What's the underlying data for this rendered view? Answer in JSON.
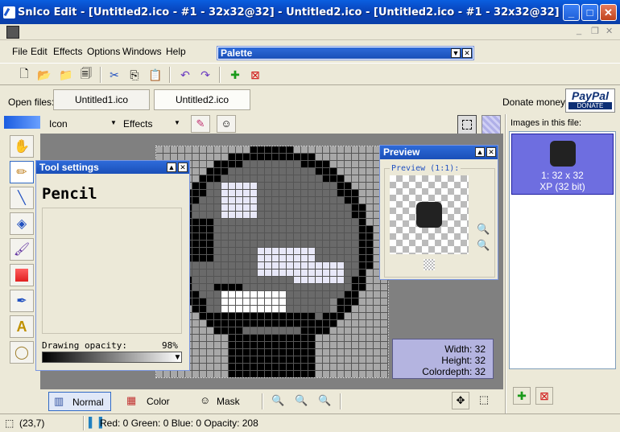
{
  "window": {
    "title": "SnIco Edit - [Untitled2.ico - #1 - 32x32@32] - Untitled2.ico - [Untitled2.ico - #1 - 32x32@32]"
  },
  "menu": [
    "File",
    "Edit",
    "Effects",
    "Options",
    "Windows",
    "Help"
  ],
  "palette": {
    "title": "Palette"
  },
  "open_files": {
    "label": "Open files:",
    "tabs": [
      "Untitled1.ico",
      "Untitled2.ico"
    ],
    "donate_label": "Donate money:",
    "paypal_top": "PayPal",
    "paypal_bottom": "DONATE"
  },
  "secondary": {
    "icon_dropdown": "Icon",
    "effects_dropdown": "Effects"
  },
  "tool_settings": {
    "title": "Tool settings",
    "tool_name": "Pencil",
    "opacity_label": "Drawing opacity:",
    "opacity_value": "98%",
    "opacity_fraction": 0.98
  },
  "preview": {
    "title": "Preview",
    "group_label": "Preview (1:1):"
  },
  "info": {
    "width": "Width: 32",
    "height": "Height: 32",
    "colordepth": "Colordepth: 32"
  },
  "bottom": {
    "normal": "Normal",
    "color": "Color",
    "mask": "Mask"
  },
  "images_panel": {
    "title": "Images in this file:",
    "item_line1": "1: 32 x 32",
    "item_line2": "XP (32 bit)"
  },
  "status": {
    "coords": "(23,7)",
    "color_info": "Red: 0 Green: 0 Blue: 0 Opacity: 208"
  },
  "colors": {
    "title_blue": "#0a4fd0",
    "selection": "#6e6ee0",
    "info_box": "#b4b4e0"
  }
}
